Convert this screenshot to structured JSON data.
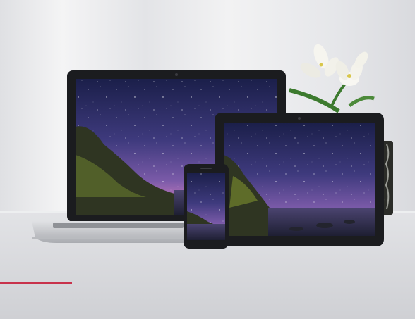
{
  "scene": {
    "description_icons": [
      "laptop-icon",
      "tablet-icon",
      "phone-icon",
      "flower-icon",
      "vase-icon"
    ],
    "colors": {
      "accent_line": "#c8324b",
      "wall": "#e9eaec",
      "table": "#dcdde0",
      "device_frame": "#1b1c1f",
      "laptop_body": "#c9cbcf",
      "sky_top": "#1b1f4a",
      "sky_mid": "#5b4a93",
      "sky_glow": "#b873b9",
      "sea": "#3a3a5c",
      "rock": "#2f3522"
    }
  }
}
